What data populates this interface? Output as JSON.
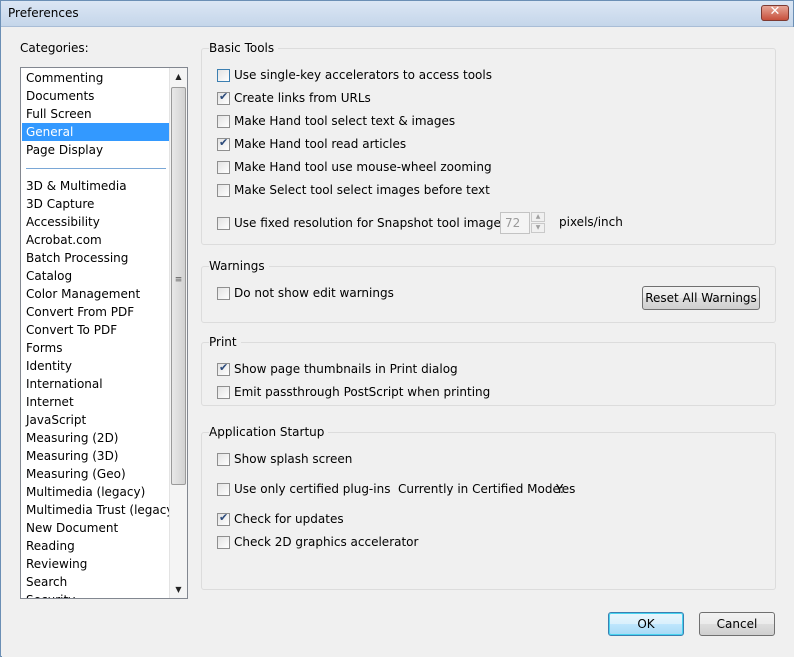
{
  "window": {
    "title": "Preferences"
  },
  "categories": {
    "label": "Categories:",
    "items_top": [
      "Commenting",
      "Documents",
      "Full Screen",
      "General",
      "Page Display"
    ],
    "selected": "General",
    "items_bottom": [
      "3D & Multimedia",
      "3D Capture",
      "Accessibility",
      "Acrobat.com",
      "Batch Processing",
      "Catalog",
      "Color Management",
      "Convert From PDF",
      "Convert To PDF",
      "Forms",
      "Identity",
      "International",
      "Internet",
      "JavaScript",
      "Measuring (2D)",
      "Measuring (3D)",
      "Measuring (Geo)",
      "Multimedia (legacy)",
      "Multimedia Trust (legacy)",
      "New Document",
      "Reading",
      "Reviewing",
      "Search",
      "Security"
    ]
  },
  "basic_tools": {
    "title": "Basic Tools",
    "single_key": {
      "label": "Use single-key accelerators to access tools",
      "checked": false
    },
    "create_links": {
      "label": "Create links from URLs",
      "checked": true
    },
    "hand_select_text": {
      "label": "Make Hand tool select text & images",
      "checked": false
    },
    "hand_read_articles": {
      "label": "Make Hand tool read articles",
      "checked": true
    },
    "hand_wheel_zoom": {
      "label": "Make Hand tool use mouse-wheel zooming",
      "checked": false
    },
    "select_images_first": {
      "label": "Make Select tool select images before text",
      "checked": false
    },
    "fixed_resolution": {
      "label": "Use fixed resolution for Snapshot tool images:",
      "checked": false
    },
    "resolution_value": "72",
    "resolution_unit": "pixels/inch"
  },
  "warnings": {
    "title": "Warnings",
    "no_edit_warnings": {
      "label": "Do not show edit warnings",
      "checked": false
    },
    "reset_button": "Reset All Warnings"
  },
  "print": {
    "title": "Print",
    "show_thumbnails": {
      "label": "Show page thumbnails in Print dialog",
      "checked": true
    },
    "emit_passthrough": {
      "label": "Emit passthrough PostScript when printing",
      "checked": false
    }
  },
  "startup": {
    "title": "Application Startup",
    "splash": {
      "label": "Show splash screen",
      "checked": false
    },
    "certified_only": {
      "label": "Use only certified plug-ins",
      "checked": false
    },
    "certified_mode_label": "Currently in Certified Mode:",
    "certified_mode_value": "Yes",
    "check_updates": {
      "label": "Check for updates",
      "checked": true
    },
    "check_2d": {
      "label": "Check 2D graphics accelerator",
      "checked": false
    }
  },
  "buttons": {
    "ok": "OK",
    "cancel": "Cancel"
  }
}
